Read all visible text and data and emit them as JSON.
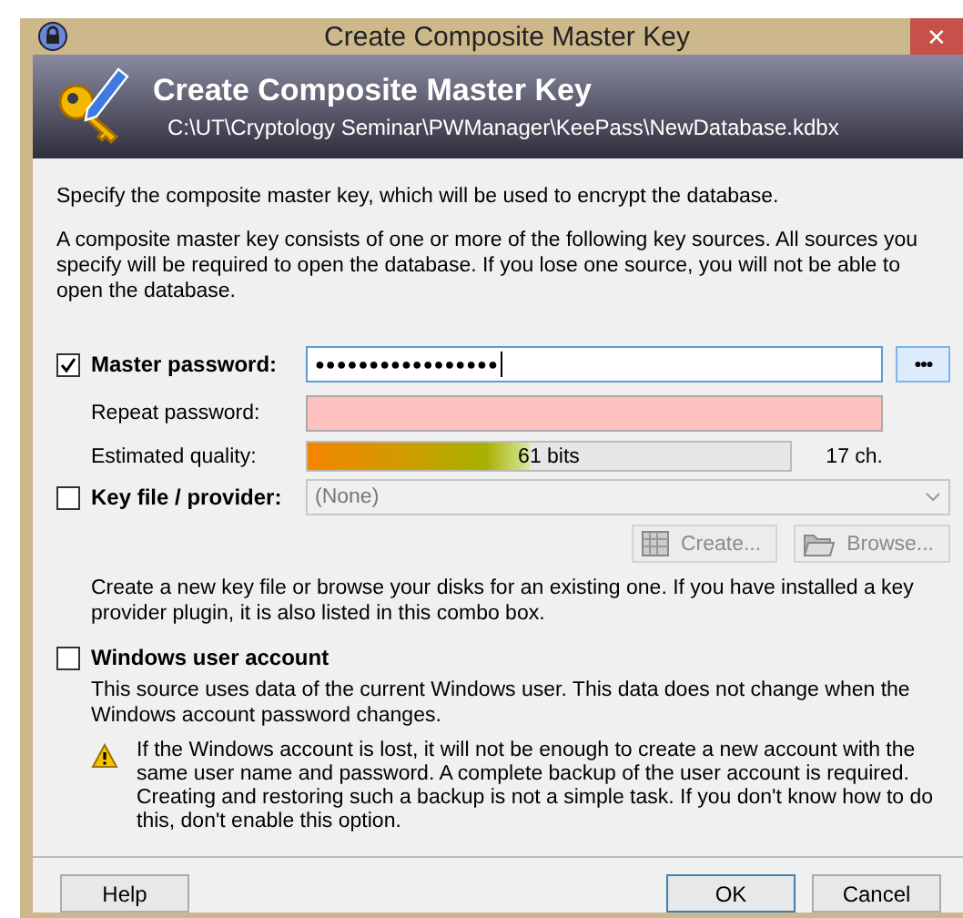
{
  "window": {
    "title": "Create Composite Master Key",
    "close": "✕"
  },
  "banner": {
    "title": "Create Composite Master Key",
    "path": "C:\\UT\\Cryptology Seminar\\PWManager\\KeePass\\NewDatabase.kdbx"
  },
  "intro": [
    "Specify the composite master key, which will be used to encrypt the database.",
    "A composite master key consists of one or more of the following key sources. All sources you specify will be required to open the database.  If you lose one source, you will not be able to open the database."
  ],
  "master_password": {
    "label": "Master password:",
    "checked": true,
    "value": "●●●●●●●●●●●●●●●●●",
    "show_button": "●●●",
    "repeat_label": "Repeat password:",
    "repeat_mismatch": true,
    "quality_label": "Estimated quality:",
    "quality": {
      "level": 0.46,
      "reading": "61 bits"
    },
    "length": "17 ch."
  },
  "key_file": {
    "label": "Key file / provider:",
    "checked": false,
    "selection": "(None)",
    "buttons": [
      {
        "kind": "create",
        "label": "Create...",
        "disabled": true
      },
      {
        "kind": "browse",
        "label": "Browse...",
        "disabled": true
      }
    ],
    "description": "Create a new key file or browse your disks for an existing one. If you have installed a key provider plugin, it is also listed in this combo box."
  },
  "windows_account": {
    "label": "Windows user account",
    "checked": false,
    "description": "This source uses data of the current Windows user. This data does not change when the Windows account password changes.",
    "warning": "If the Windows account is lost, it will not be enough to create a new account with the same user name and password. A complete backup of the user account is required. Creating and restoring such a backup is not a simple task. If you don't know how to do this, don't enable this option."
  },
  "buttons": [
    {
      "label": "Help",
      "default": false
    },
    {
      "label": "OK",
      "default": true
    },
    {
      "label": "Cancel",
      "default": false
    }
  ]
}
